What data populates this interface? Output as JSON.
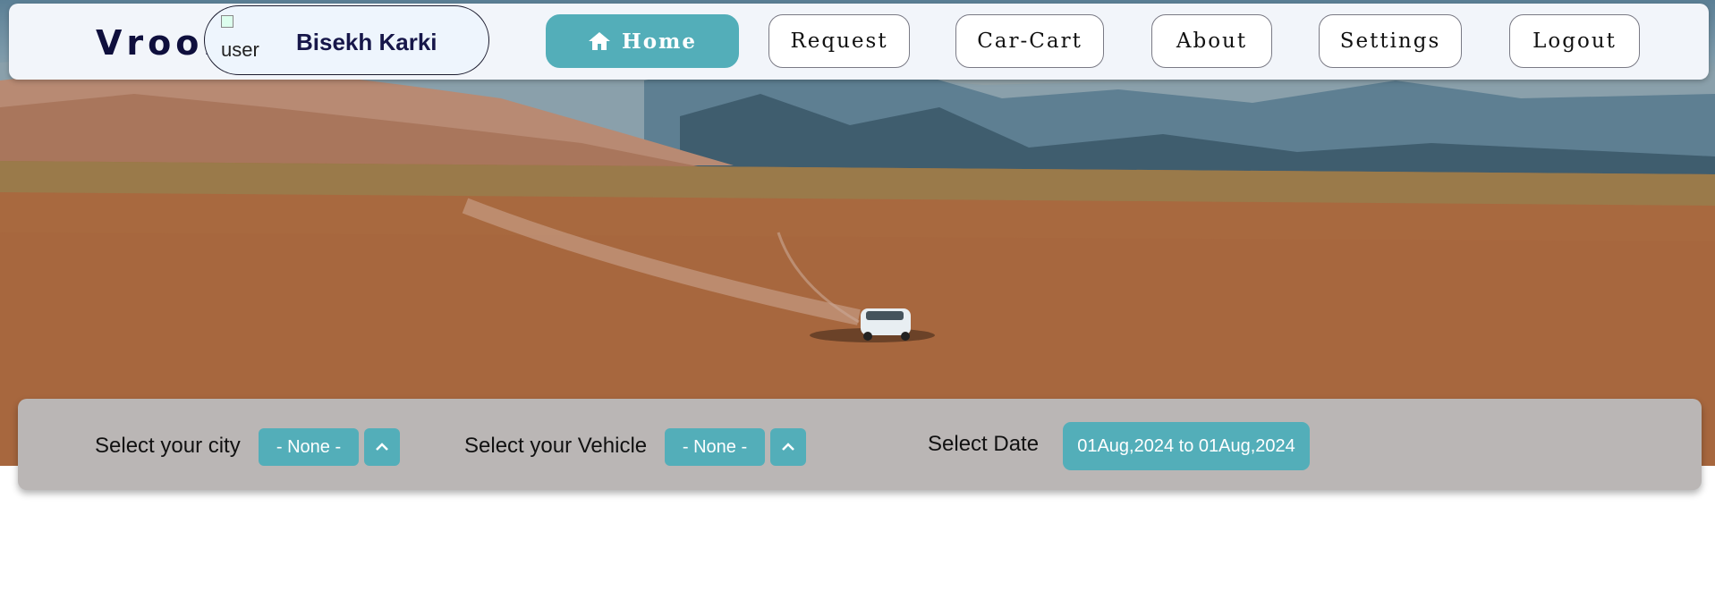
{
  "brand": "Vroom",
  "user": {
    "avatar_alt": "user profile",
    "name": "Bisekh Karki"
  },
  "nav": {
    "home": "Home",
    "request": "Request",
    "car_cart": "Car-Cart",
    "about": "About",
    "settings": "Settings",
    "logout": "Logout"
  },
  "filters": {
    "city_label": "Select your city",
    "city_value": "- None -",
    "vehicle_label": "Select your Vehicle",
    "vehicle_value": "- None -",
    "date_label": "Select Date",
    "date_value": "01Aug,2024 to 01Aug,2024"
  },
  "colors": {
    "accent": "#53aeb9",
    "brand_text": "#0f0f3d",
    "panel_bg": "#bab6b5",
    "navbar_bg": "#f2f5fa"
  },
  "icons": {
    "home": "home-icon",
    "chevron": "chevron-up-icon"
  }
}
